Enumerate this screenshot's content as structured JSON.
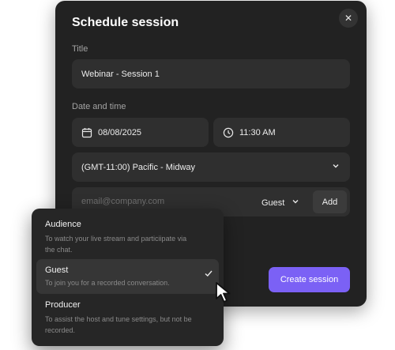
{
  "modal": {
    "title": "Schedule session",
    "close_label": "✕"
  },
  "form": {
    "title_label": "Title",
    "title_value": "Webinar - Session 1",
    "datetime_label": "Date and time",
    "date_value": "08/08/2025",
    "time_value": "11:30 AM",
    "timezone_value": "(GMT-11:00) Pacific - Midway"
  },
  "invite": {
    "email_placeholder": "email@company.com",
    "role_value": "Guest",
    "add_label": "Add"
  },
  "actions": {
    "create_label": "Create session"
  },
  "role_menu": {
    "options": [
      {
        "title": "Audience",
        "description": "To watch your live stream and particiipate via the chat."
      },
      {
        "title": "Guest",
        "description": "To join you for a recorded conversation.",
        "selected": true
      },
      {
        "title": "Producer",
        "description": "To assist the host and tune settings, but not be recorded."
      }
    ]
  },
  "colors": {
    "modal_bg": "#222222",
    "field_bg": "#2f2f2f",
    "accent": "#7b61f5"
  },
  "icons": [
    "close-icon",
    "calendar-icon",
    "clock-icon",
    "chevron-down-icon",
    "check-icon",
    "mouse-pointer-icon"
  ]
}
